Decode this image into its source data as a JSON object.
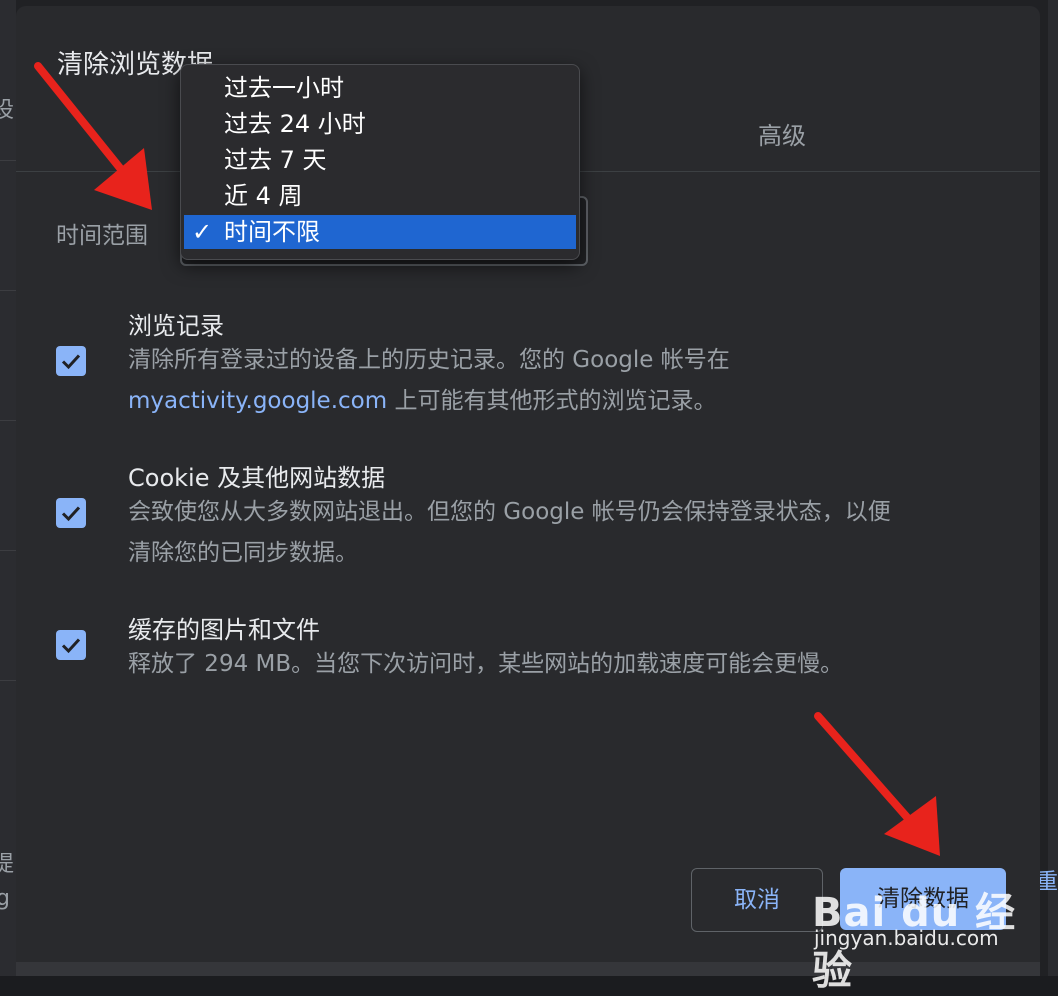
{
  "dialog": {
    "title": "清除浏览数据",
    "tab_advanced": "高级",
    "time_range_label": "时间范围",
    "dropdown_options": [
      {
        "label": "过去一小时",
        "selected": false
      },
      {
        "label": "过去 24 小时",
        "selected": false
      },
      {
        "label": "过去 7 天",
        "selected": false
      },
      {
        "label": "近 4 周",
        "selected": false
      },
      {
        "label": "时间不限",
        "selected": true
      }
    ],
    "check_mark": "✓",
    "items": [
      {
        "title": "浏览记录",
        "desc_line1": "清除所有登录过的设备上的历史记录。您的 Google 帐号在",
        "desc_link": "myactivity.google.com",
        "desc_line2_rest": " 上可能有其他形式的浏览记录。",
        "checked": true
      },
      {
        "title": "Cookie 及其他网站数据",
        "desc_line1": "会致使您从大多数网站退出。但您的 Google 帐号仍会保持登录状态，以便",
        "desc_line2": "清除您的已同步数据。",
        "checked": true
      },
      {
        "title": "缓存的图片和文件",
        "desc_line1": "释放了 294 MB。当您下次访问时，某些网站的加载速度可能会更慢。",
        "checked": true
      }
    ],
    "cancel_label": "取消",
    "clear_label": "清除数据"
  },
  "background": {
    "frag_1": "设",
    "frag_2": "提",
    "frag_3": "g",
    "frag_right": "重"
  },
  "watermark": {
    "logo": "Bai du 经验",
    "url": "jingyan.baidu.com"
  },
  "colors": {
    "accent": "#8ab4f8",
    "selected_option": "#1f66d1",
    "annotation_arrow": "#e8231c"
  }
}
